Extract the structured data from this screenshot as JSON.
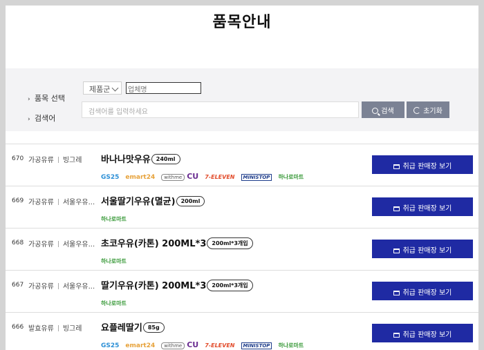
{
  "page": {
    "title": "품목안내"
  },
  "filter": {
    "category_label": "품목 선택",
    "category_select": "제품군",
    "company_placeholder": "업체명",
    "search_label": "검색어",
    "search_placeholder": "검색어를 입력하세요",
    "search_button": "검색",
    "reset_button": "초기화"
  },
  "colors": {
    "primary_button": "#1f2aa3",
    "secondary_button": "#7b8294"
  },
  "products": [
    {
      "no": "670",
      "category": "가공유류",
      "maker": "빙그레",
      "name": "바나나맛우유",
      "size": "240ml",
      "stores": [
        "GS25",
        "emart24",
        "withme",
        "CU",
        "7-ELEVEN",
        "MINISTOP",
        "하나로마트"
      ],
      "button": "취급 판매장 보기"
    },
    {
      "no": "669",
      "category": "가공유류",
      "maker": "서울우유...",
      "name": "서울딸기우유(멸균)",
      "size": "200ml",
      "stores": [
        "하나로마트"
      ],
      "button": "취급 판매장 보기"
    },
    {
      "no": "668",
      "category": "가공유류",
      "maker": "서울우유...",
      "name": "초코우유(카톤) 200ML*3",
      "size": "200ml*3개입",
      "stores": [
        "하나로마트"
      ],
      "button": "취급 판매장 보기"
    },
    {
      "no": "667",
      "category": "가공유류",
      "maker": "서울우유...",
      "name": "딸기우유(카톤) 200ML*3",
      "size": "200ml*3개입",
      "stores": [
        "하나로마트"
      ],
      "button": "취급 판매장 보기"
    },
    {
      "no": "666",
      "category": "발효유류",
      "maker": "빙그레",
      "name": "요플레딸기",
      "size": "85g",
      "stores": [
        "GS25",
        "emart24",
        "withme",
        "CU",
        "7-ELEVEN",
        "MINISTOP",
        "하나로마트"
      ],
      "button": "취급 판매장 보기"
    }
  ]
}
